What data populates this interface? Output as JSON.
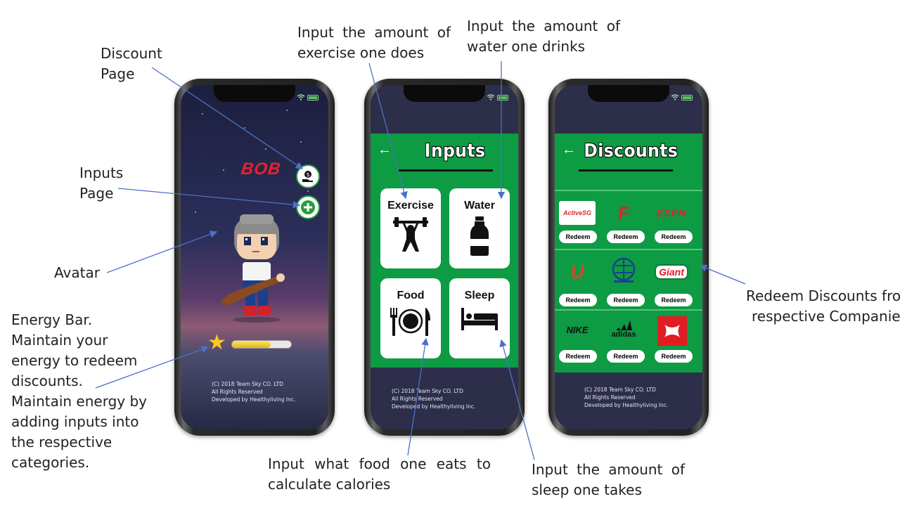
{
  "annotations": {
    "discount_page": "Discount Page",
    "inputs_page": "Inputs Page",
    "avatar": "Avatar",
    "energy_bar_1": "Energy Bar.",
    "energy_bar_2": "Maintain your",
    "energy_bar_3": "energy to redeem",
    "energy_bar_4": "discounts.",
    "energy_bar_5": "Maintain energy by",
    "energy_bar_6": "adding inputs into",
    "energy_bar_7": "the respective",
    "energy_bar_8": "categories.",
    "exercise_1": "Input the amount of",
    "exercise_2": "exercise one does",
    "water_1": "Input the amount of",
    "water_2": "water one drinks",
    "food_1": "Input what food one eats to",
    "food_2": "calculate calories",
    "sleep_1": "Input the amount of",
    "sleep_2": "sleep one takes",
    "redeem_1": "Redeem Discounts from",
    "redeem_2": "respective Companies"
  },
  "home": {
    "name": "BOB",
    "energy_level": 0.65,
    "footer": [
      "(C) 2018 Team Sky CO. LTD",
      "All Rights Reserved",
      "Developed by Healthyliving Inc."
    ],
    "discount_icon": "coin-hand-icon",
    "add_icon": "plus-icon"
  },
  "inputs": {
    "title": "Inputs",
    "back": "←",
    "cards": [
      {
        "label": "Exercise",
        "icon": "weightlifter-icon"
      },
      {
        "label": "Water",
        "icon": "bottle-icon"
      },
      {
        "label": "Food",
        "icon": "plate-cutlery-icon"
      },
      {
        "label": "Sleep",
        "icon": "bed-icon"
      }
    ],
    "footer": [
      "(C) 2018 Team Sky CO. LTD",
      "All Rights Reserved",
      "Developed by Healthyliving Inc."
    ]
  },
  "discounts": {
    "title": "Discounts",
    "back": "←",
    "redeem_label": "Redeem",
    "companies": [
      {
        "logo": "ActiveSG",
        "color": "#d8262e"
      },
      {
        "logo": "F",
        "color": "#d8262e"
      },
      {
        "logo": "ESPN",
        "color": "#d8262e"
      },
      {
        "logo": "U",
        "color": "#e0412c"
      },
      {
        "logo": "globe-logo",
        "color": "#1d3f8f"
      },
      {
        "logo": "Giant",
        "color": "#e21c23"
      },
      {
        "logo": "NIKE",
        "color": "#111111"
      },
      {
        "logo": "adidas",
        "color": "#111111"
      },
      {
        "logo": "under-armour-logo",
        "color": "#e21c23"
      }
    ],
    "footer": [
      "(C) 2018 Team Sky CO. LTD",
      "All Rights Reserved",
      "Developed by Healthyliving Inc."
    ]
  },
  "colors": {
    "green": "#0d9b43",
    "dark": "#2c2e4a",
    "arrow": "#4a72c4"
  }
}
